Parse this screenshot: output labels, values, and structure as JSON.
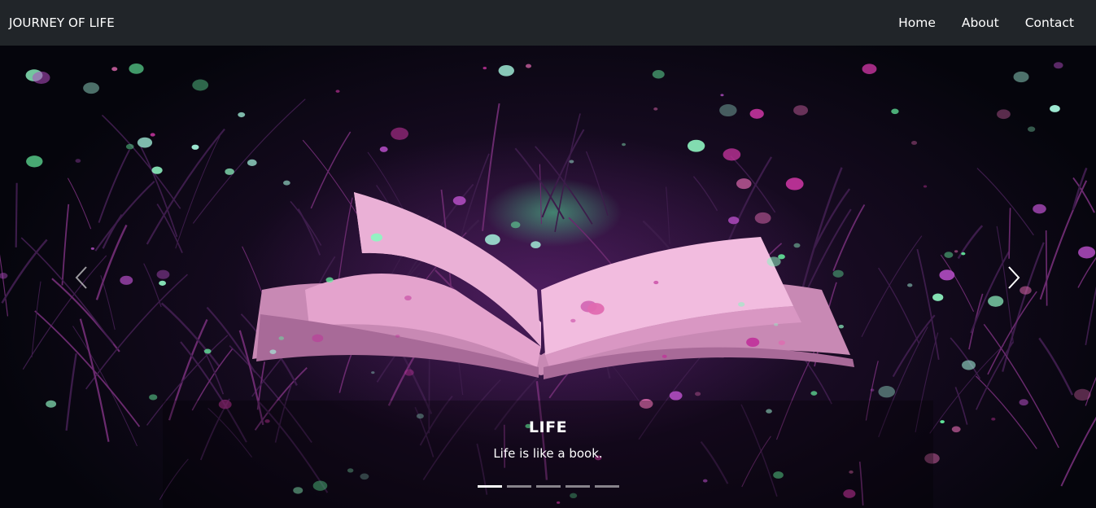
{
  "navbar": {
    "brand": "JOURNEY OF LIFE",
    "links": [
      {
        "label": "Home"
      },
      {
        "label": "About"
      },
      {
        "label": "Contact"
      }
    ]
  },
  "carousel": {
    "slide": {
      "title": "LIFE",
      "text": "Life is like a book."
    },
    "prev_icon": "chevron-left-icon",
    "next_icon": "chevron-right-icon",
    "indicator_count": 5,
    "active_index": 0
  },
  "colors": {
    "navbar_bg": "#212529",
    "nav_text": "#ffffff",
    "book_page": "#e8a6cf",
    "glow_green": "#66f0a0",
    "petal_magenta": "#c0339a"
  }
}
